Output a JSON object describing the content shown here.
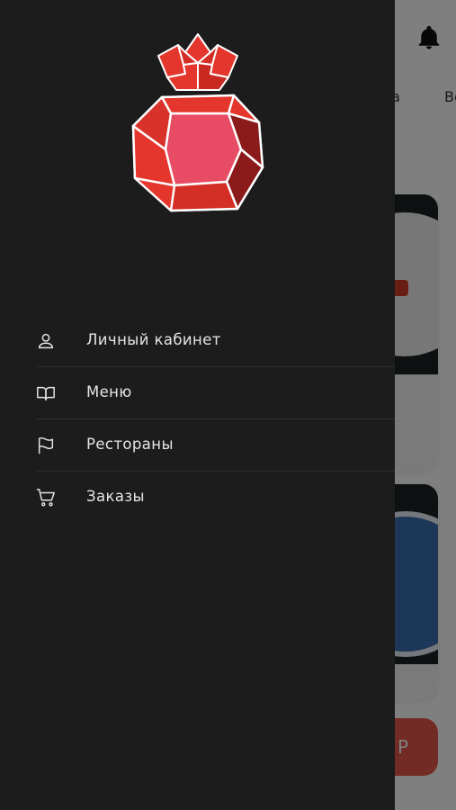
{
  "background": {
    "tabs": [
      "да",
      "Ве"
    ],
    "price_button_label": "Р"
  },
  "drawer": {
    "logo": "garnet-gem-crown-logo",
    "menu": [
      {
        "label": "Личный кабинет",
        "icon": "user-icon"
      },
      {
        "label": "Меню",
        "icon": "book-icon"
      },
      {
        "label": "Рестораны",
        "icon": "flag-icon"
      },
      {
        "label": "Заказы",
        "icon": "cart-icon"
      }
    ]
  },
  "colors": {
    "drawer_bg": "#1c1c1c",
    "accent_red": "#e4362c",
    "gem_pink": "#e84b64",
    "gem_dark": "#8b1a1a"
  }
}
